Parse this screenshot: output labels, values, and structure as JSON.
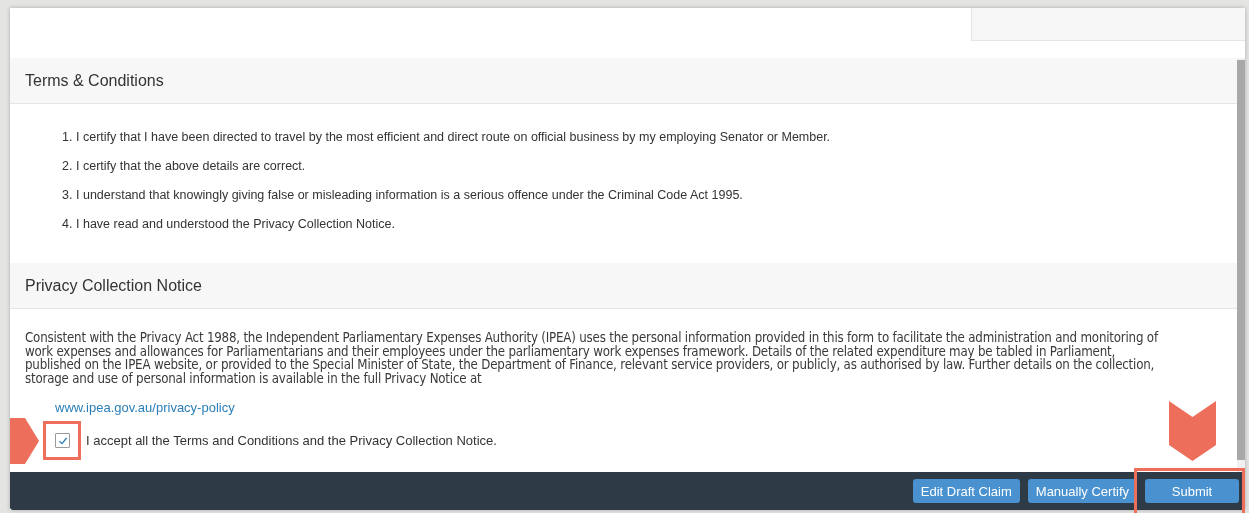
{
  "sections": [
    {
      "title": "Terms & Conditions",
      "kind": "list",
      "items": [
        "I certify that I have been directed to travel by the most efficient and direct route on official business by my employing Senator or Member.",
        "I certify that the above details are correct.",
        "I understand that knowingly giving false or misleading information is a serious offence under the Criminal Code Act 1995.",
        "I have read and understood the Privacy Collection Notice."
      ],
      "numbers": [
        "1.",
        "2.",
        "3.",
        "4."
      ]
    },
    {
      "title": "Privacy Collection Notice",
      "kind": "notice",
      "text": "Consistent with the Privacy Act 1988, the Independent Parliamentary Expenses Authority (IPEA) uses the personal information provided in this form to facilitate the administration and monitoring of work expenses and allowances for Parliamentarians and their employees under the parliamentary work expenses framework. Details of the related expenditure may be tabled in Parliament, published on the IPEA website, or provided to the Special Minister of State, the Department of Finance, relevant service providers, or publicly, as authorised by law. Further details on the collection, storage and use of personal  information is available in the full  Privacy Notice at",
      "link": "www.ipea.gov.au/privacy-policy"
    }
  ],
  "accept": {
    "label": "I accept all the Terms and Conditions and the Privacy Collection Notice.",
    "checked": true,
    "highlighted": true,
    "pointed": true
  },
  "buttons": [
    {
      "label": "Edit Draft Claim",
      "highlighted": false,
      "pointed": false
    },
    {
      "label": "Manually Certify",
      "highlighted": false,
      "pointed": false
    },
    {
      "label": "Submit",
      "highlighted": true,
      "pointed": true
    }
  ]
}
